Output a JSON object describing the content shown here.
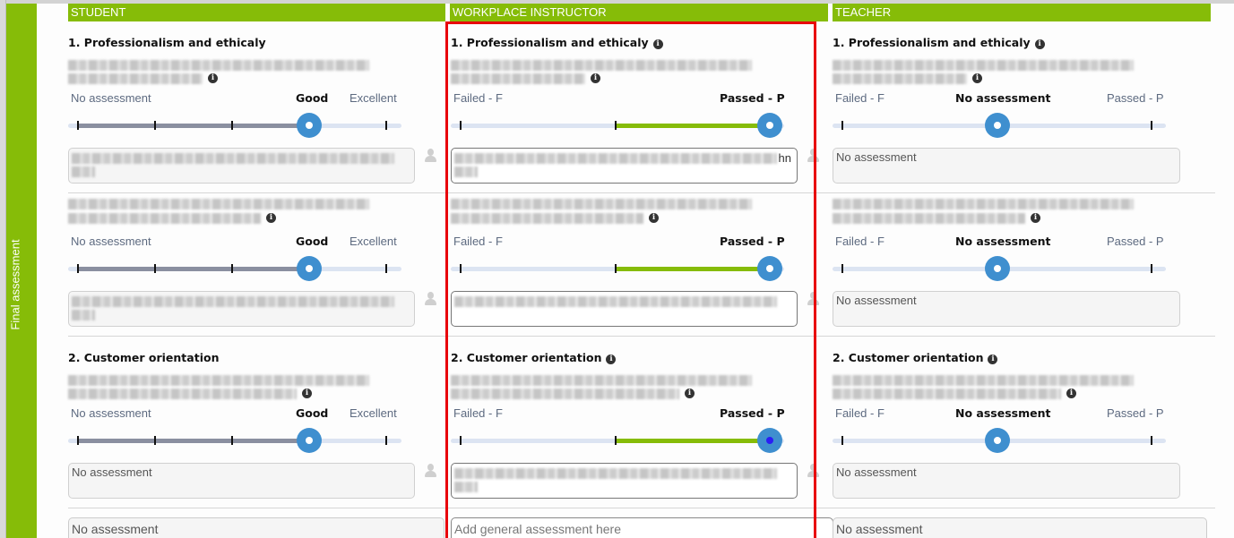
{
  "sidebar": {
    "label": "Final assessment"
  },
  "columns": [
    {
      "header": "STUDENT"
    },
    {
      "header": "WORKPLACE INSTRUCTOR"
    },
    {
      "header": "TEACHER"
    }
  ],
  "criteria": {
    "c1_title": "1. Professionalism and ethicaly",
    "c2_title": "2. Customer orientation",
    "info_glyph": "i"
  },
  "student_scale": {
    "labels": [
      "No assessment",
      "Good",
      "Excellent"
    ],
    "selected": "Good",
    "steps": 5,
    "value_index": 3
  },
  "pass_fail_scale": {
    "failed": "Failed - F",
    "passed": "Passed - P",
    "no_assessment": "No assessment"
  },
  "student": {
    "rows": [
      {
        "selected": "Good",
        "value_index": 3,
        "comment_blurred": true
      },
      {
        "selected": "Good",
        "value_index": 3,
        "comment_blurred": true
      },
      {
        "selected": "Good",
        "value_index": 3,
        "comment": "No assessment"
      }
    ],
    "general": "No assessment"
  },
  "instructor": {
    "rows": [
      {
        "selected": "Passed - P",
        "value_fraction": 1.0,
        "comment_blurred": true,
        "comment_visible_fragment": "hn"
      },
      {
        "selected": "Passed - P",
        "value_fraction": 1.0,
        "comment_blurred": true
      },
      {
        "selected": "Passed - P",
        "value_fraction": 1.0,
        "comment_blurred": true,
        "focused": true
      }
    ],
    "general_placeholder": "Add general assessment here",
    "general_value": ""
  },
  "teacher": {
    "rows": [
      {
        "selected": "No assessment",
        "value_fraction": 0.5,
        "comment": "No assessment"
      },
      {
        "selected": "No assessment",
        "value_fraction": 0.5,
        "comment": "No assessment"
      },
      {
        "selected": "No assessment",
        "value_fraction": 0.5,
        "comment": "No assessment"
      }
    ],
    "general": "No assessment"
  },
  "colors": {
    "brand_green": "#86bc08",
    "slider_knob": "#3f8fcf",
    "student_fill": "#8a8fa0",
    "instructor_fill": "#86bc08",
    "highlight_outline": "#e8000b"
  },
  "icons": {
    "info": "info-circle-icon",
    "user": "user-silhouette-icon"
  }
}
